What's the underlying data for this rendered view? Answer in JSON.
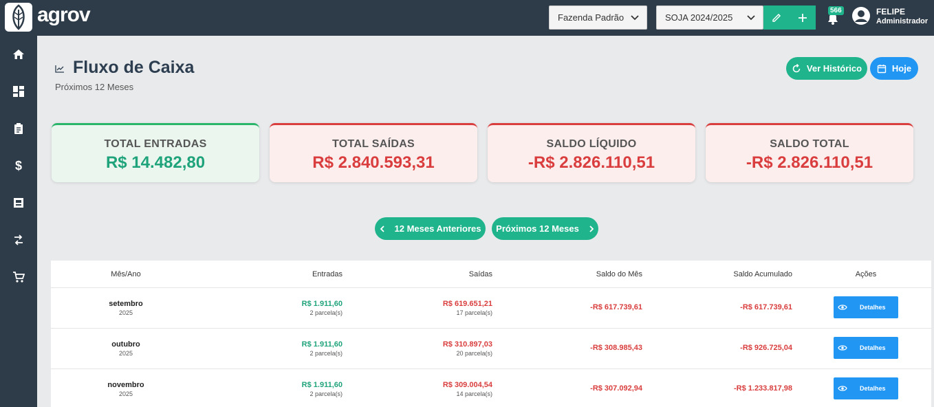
{
  "app": {
    "name": "agrov"
  },
  "header": {
    "farm_select": "Fazenda Padrão",
    "season_select": "SOJA 2024/2025",
    "notifications_count": "566",
    "user_name": "FELIPE",
    "user_role": "Administrador"
  },
  "sidebar": {
    "items": [
      {
        "icon": "home-icon"
      },
      {
        "icon": "dashboard-icon"
      },
      {
        "icon": "clipboard-icon"
      },
      {
        "icon": "dollar-icon"
      },
      {
        "icon": "inventory-icon"
      },
      {
        "icon": "transfer-icon"
      },
      {
        "icon": "cart-icon"
      }
    ]
  },
  "page": {
    "title": "Fluxo de Caixa",
    "subtitle": "Próximos 12 Meses",
    "history_button": "Ver Histórico",
    "today_button": "Hoje"
  },
  "summary": [
    {
      "label": "TOTAL ENTRADAS",
      "value": "R$ 14.482,80",
      "color": "#1fa37a"
    },
    {
      "label": "TOTAL SAÍDAS",
      "value": "R$ 2.840.593,31",
      "color": "#d93d3d"
    },
    {
      "label": "SALDO LÍQUIDO",
      "value": "-R$ 2.826.110,51",
      "color": "#d93d3d"
    },
    {
      "label": "SALDO TOTAL",
      "value": "-R$ 2.826.110,51",
      "color": "#d93d3d"
    }
  ],
  "nav": {
    "prev": "12 Meses Anteriores",
    "next": "Próximos 12 Meses"
  },
  "table": {
    "columns": [
      "Mês/Ano",
      "Entradas",
      "Saídas",
      "Saldo do Mês",
      "Saldo Acumulado",
      "Ações"
    ],
    "rows": [
      {
        "month": "setembro",
        "year": "2025",
        "in": "R$  1.911,60",
        "in_sub": "2 parcela(s)",
        "out": "R$  619.651,21",
        "out_sub": "17 parcela(s)",
        "balance": "-R$  617.739,61",
        "accum": "-R$  617.739,61",
        "action": "Detalhes"
      },
      {
        "month": "outubro",
        "year": "2025",
        "in": "R$  1.911,60",
        "in_sub": "2 parcela(s)",
        "out": "R$  310.897,03",
        "out_sub": "20 parcela(s)",
        "balance": "-R$  308.985,43",
        "accum": "-R$  926.725,04",
        "action": "Detalhes"
      },
      {
        "month": "novembro",
        "year": "2025",
        "in": "R$  1.911,60",
        "in_sub": "2 parcela(s)",
        "out": "R$  309.004,54",
        "out_sub": "14 parcela(s)",
        "balance": "-R$  307.092,94",
        "accum": "-R$  1.233.817,98",
        "action": "Detalhes"
      }
    ]
  },
  "colors": {
    "primary_green": "#1fb48c",
    "primary_blue": "#2196f3",
    "negative_red": "#d93d3d",
    "topbar": "#2e3b48"
  }
}
